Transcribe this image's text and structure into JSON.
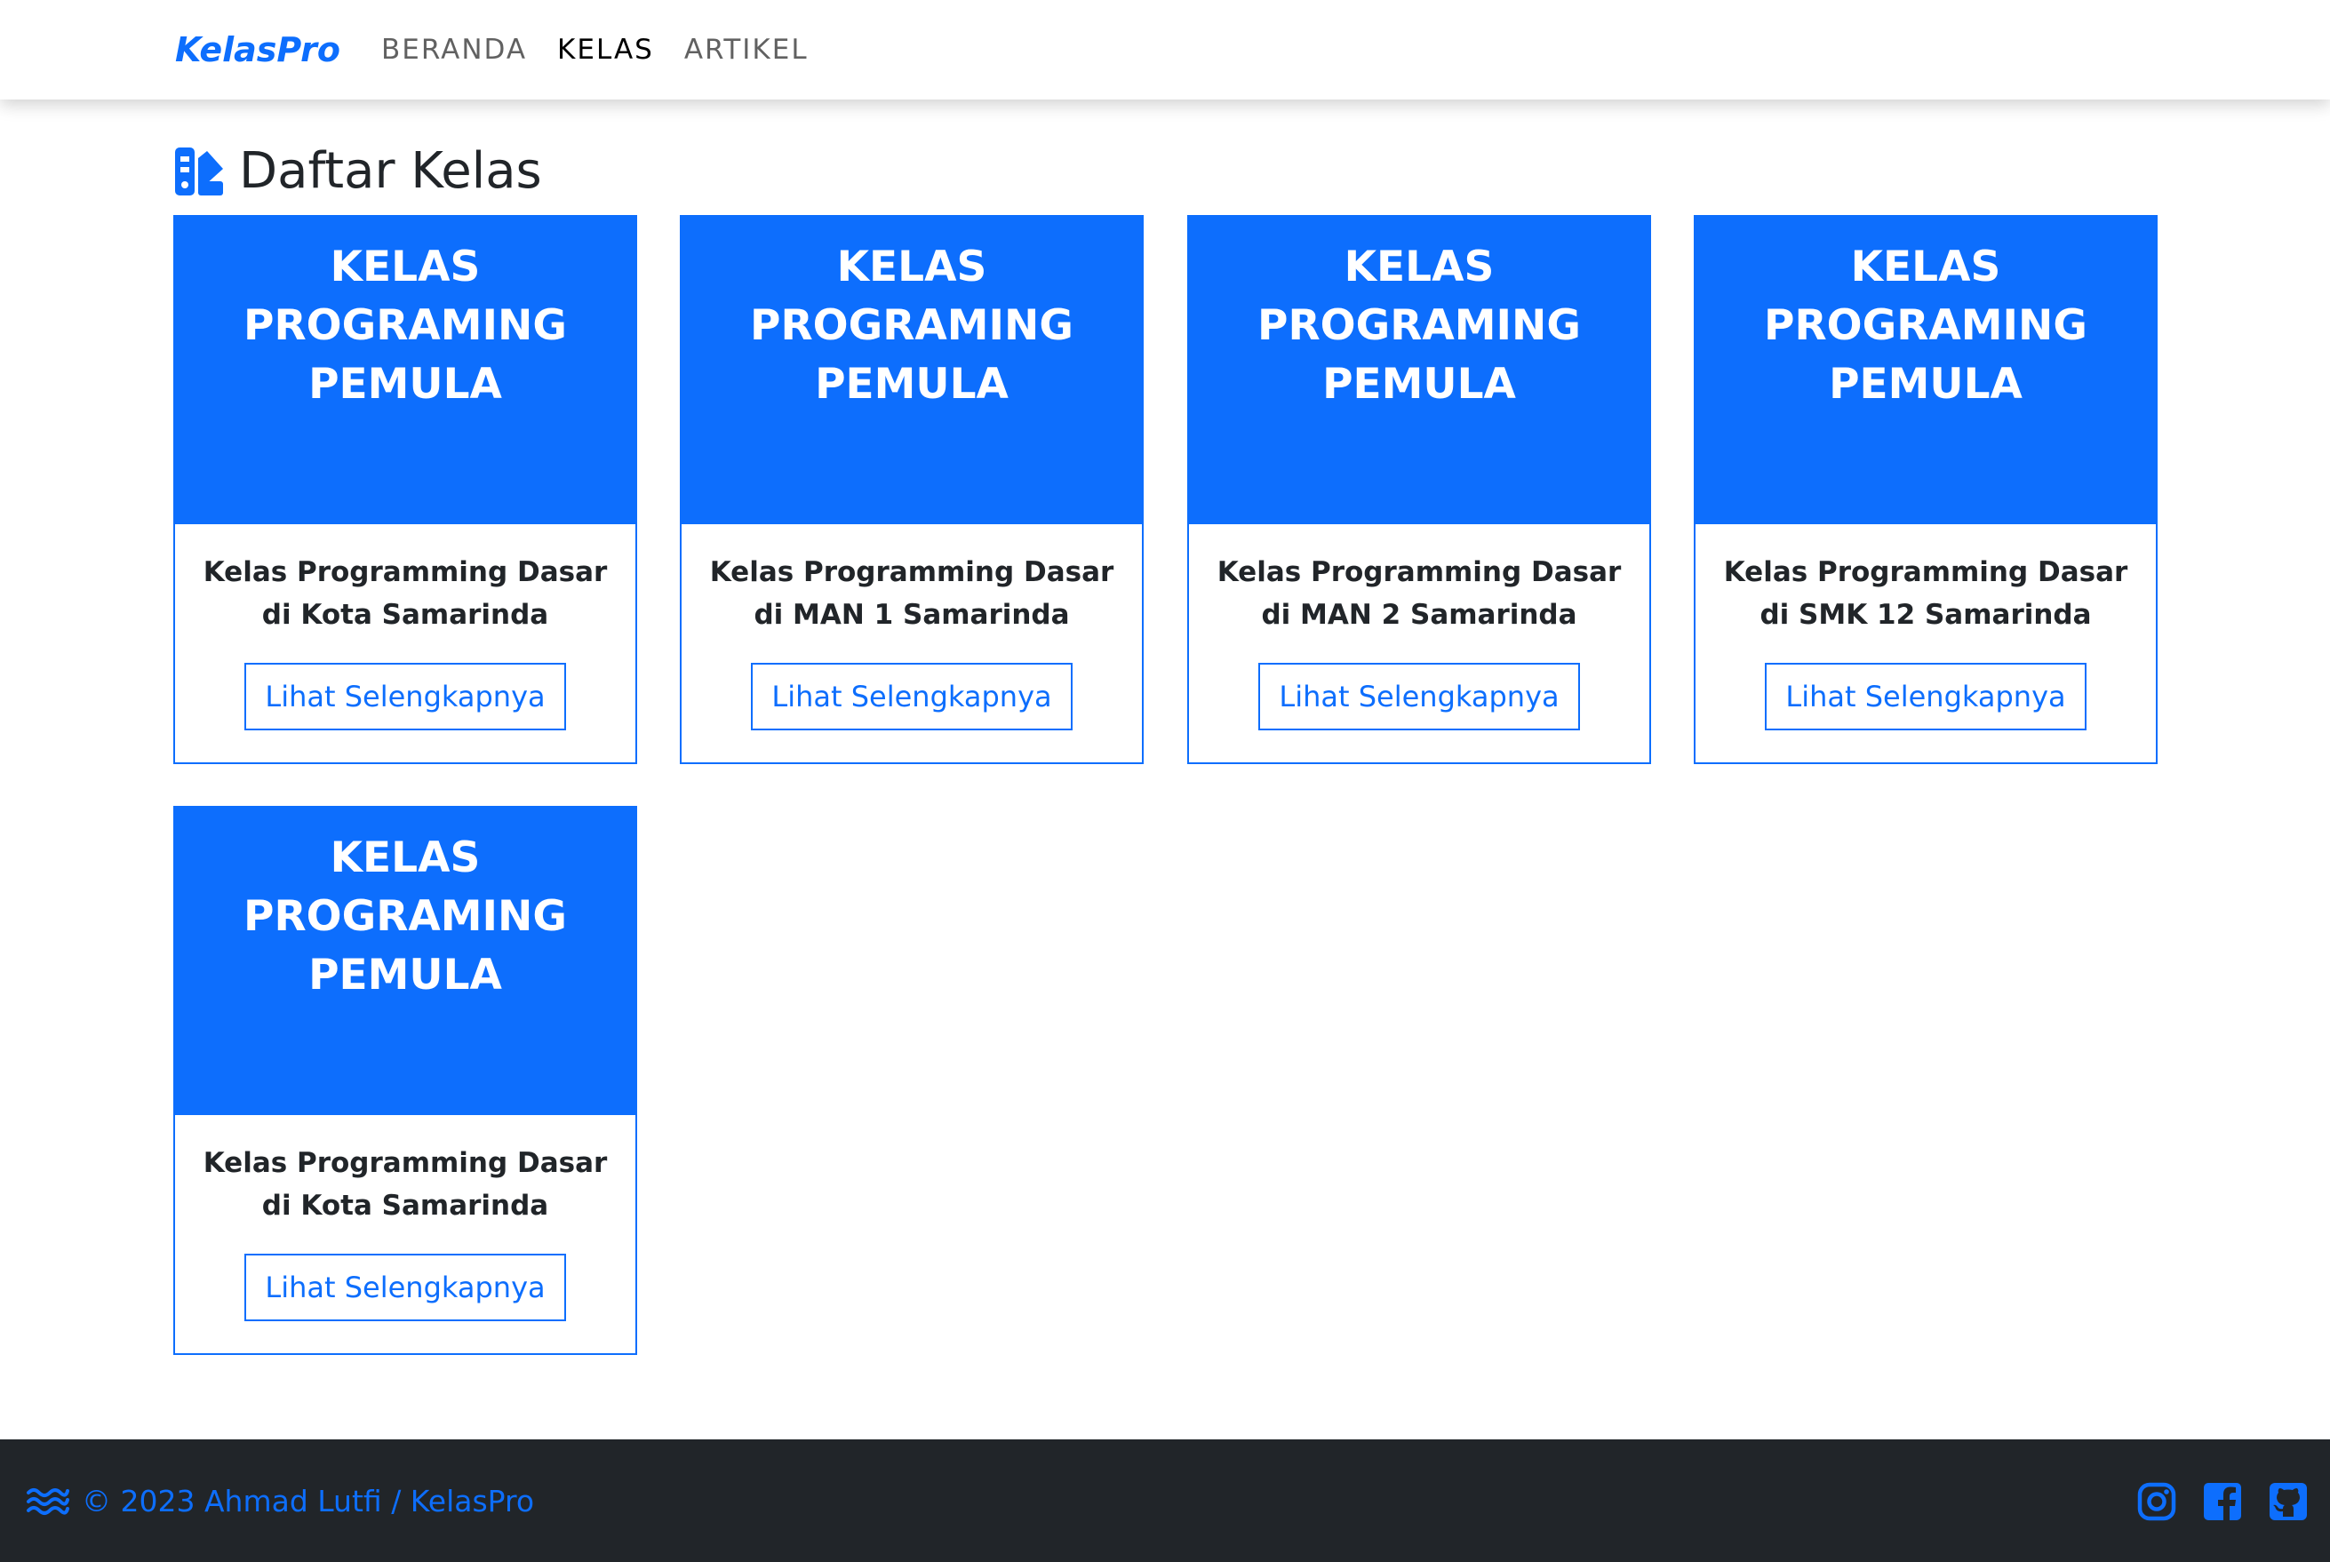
{
  "navbar": {
    "brand": "KelasPro",
    "links": [
      {
        "label": "BERANDA"
      },
      {
        "label": "KELAS"
      },
      {
        "label": "ARTIKEL"
      }
    ],
    "active": "KELAS"
  },
  "page": {
    "title": "Daftar Kelas",
    "title_icon": "swatch-book-icon"
  },
  "cards": [
    {
      "header": "KELAS PROGRAMING PEMULA",
      "description": "Kelas Programming Dasar di Kota Samarinda",
      "button": "Lihat Selengkapnya"
    },
    {
      "header": "KELAS PROGRAMING PEMULA",
      "description": "Kelas Programming Dasar di MAN 1 Samarinda",
      "button": "Lihat Selengkapnya"
    },
    {
      "header": "KELAS PROGRAMING PEMULA",
      "description": "Kelas Programming Dasar di MAN 2 Samarinda",
      "button": "Lihat Selengkapnya"
    },
    {
      "header": "KELAS PROGRAMING PEMULA",
      "description": "Kelas Programming Dasar di SMK 12 Samarinda",
      "button": "Lihat Selengkapnya"
    },
    {
      "header": "KELAS PROGRAMING PEMULA",
      "description": "Kelas Programming Dasar di Kota Samarinda",
      "button": "Lihat Selengkapnya"
    }
  ],
  "footer": {
    "text": "© 2023 Ahmad Lutfi / KelasPro",
    "logo_icon": "water-waves-icon",
    "social": [
      "instagram-icon",
      "facebook-icon",
      "github-icon"
    ]
  },
  "colors": {
    "primary": "#0d6efd",
    "footer_bg": "#212529",
    "text": "#212529"
  }
}
